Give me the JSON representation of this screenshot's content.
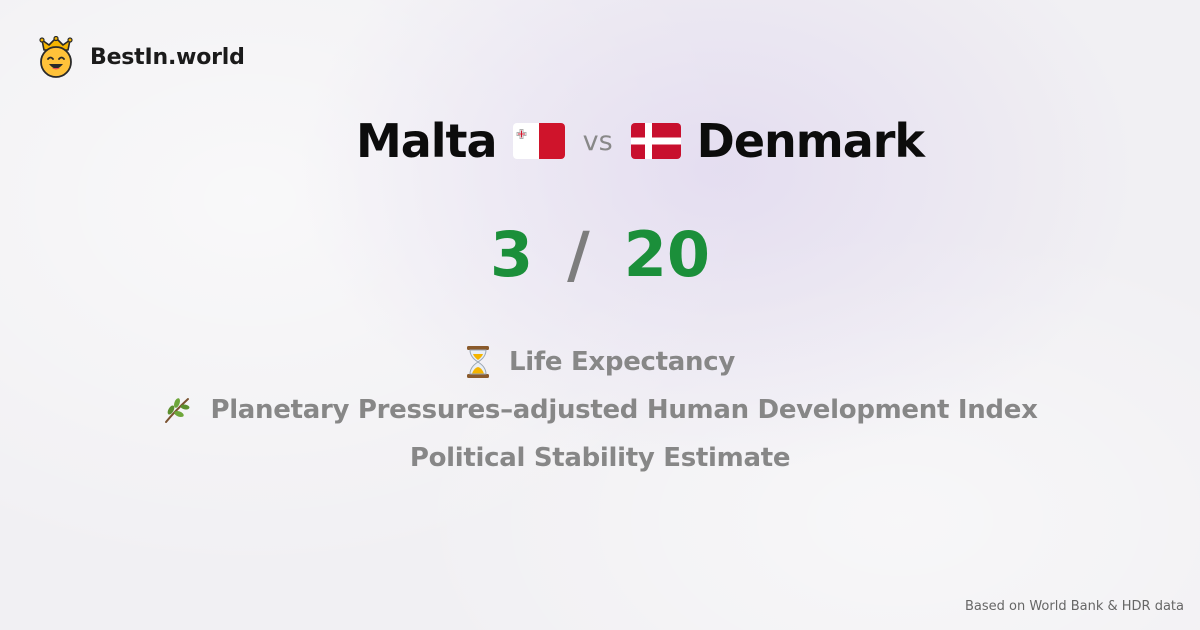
{
  "brand": {
    "name": "BestIn.world",
    "logo_icon": "crowned-smiley-icon"
  },
  "comparison": {
    "left": {
      "name": "Malta",
      "flag": "malta-flag-icon"
    },
    "vs_label": "vs",
    "right": {
      "name": "Denmark",
      "flag": "denmark-flag-icon"
    }
  },
  "score": {
    "left": "3",
    "separator": "/",
    "right": "20",
    "color": "#1b8f3a"
  },
  "metrics": [
    {
      "icon": "hourglass-icon",
      "label": "Life Expectancy"
    },
    {
      "icon": "herb-icon",
      "label": "Planetary Pressures–adjusted Human Development Index"
    },
    {
      "icon": "",
      "label": "Political Stability Estimate"
    }
  ],
  "footer": {
    "note": "Based on World Bank & HDR data"
  }
}
